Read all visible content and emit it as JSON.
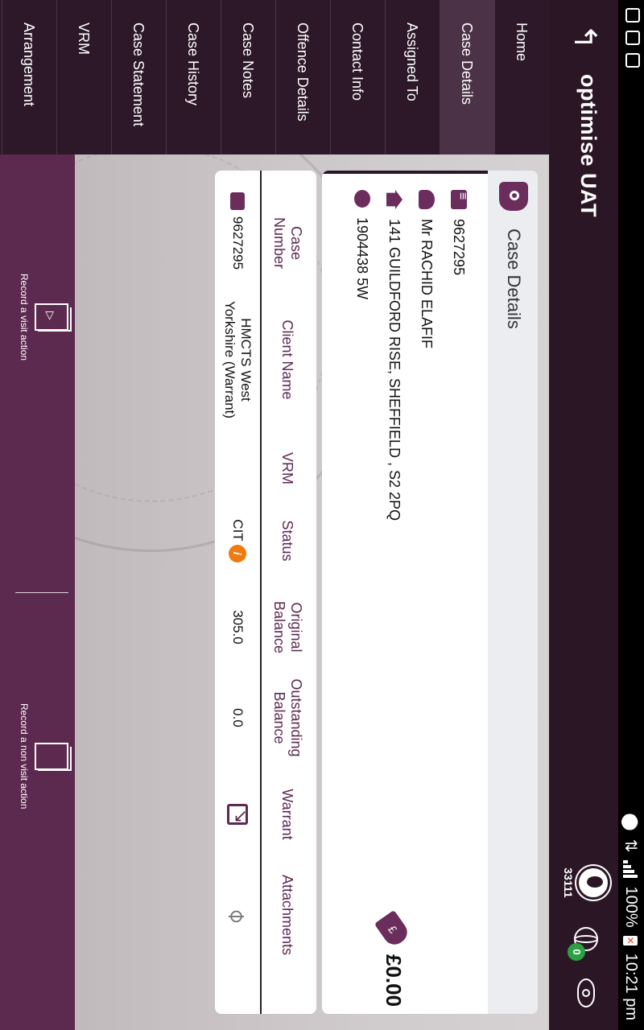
{
  "status_bar": {
    "battery": "100%",
    "time": "10:21 pm"
  },
  "app": {
    "title": "optimise UAT"
  },
  "header": {
    "user_code": "33111",
    "sync_badge": "0"
  },
  "nav": {
    "items": [
      {
        "label": "Home"
      },
      {
        "label": "Case Details"
      },
      {
        "label": "Assigned To"
      },
      {
        "label": "Contact Info"
      },
      {
        "label": "Offence Details"
      },
      {
        "label": "Case Notes"
      },
      {
        "label": "Case History"
      },
      {
        "label": "Case Statement"
      },
      {
        "label": "VRM"
      },
      {
        "label": "Arrangement"
      }
    ],
    "active": "Case Details"
  },
  "case_card": {
    "title": "Case Details",
    "case_number": "9627295",
    "client_name": "Mr RACHID ELAFIF",
    "address": "141 GUILDFORD RISE, SHEFFIELD , S2 2PQ",
    "reference": "1904438 5W",
    "balance": "£0.00"
  },
  "table": {
    "headers": [
      "Case Number",
      "Client Name",
      "VRM",
      "Status",
      "Original Balance",
      "Outstanding Balance",
      "Warrant",
      "Attachments"
    ],
    "row": {
      "case_number": "9627295",
      "client_name": "HMCTS West Yorkshire (Warrant)",
      "vrm": "",
      "status": "CIT",
      "original_balance": "305.0",
      "outstanding_balance": "0.0"
    }
  },
  "actions": {
    "visit": "Record a visit action",
    "non_visit": "Record a non visit action"
  },
  "icons": {
    "back": "back-arrow-icon",
    "user": "user-icon",
    "globe": "globe-icon",
    "eye": "eye-icon"
  }
}
